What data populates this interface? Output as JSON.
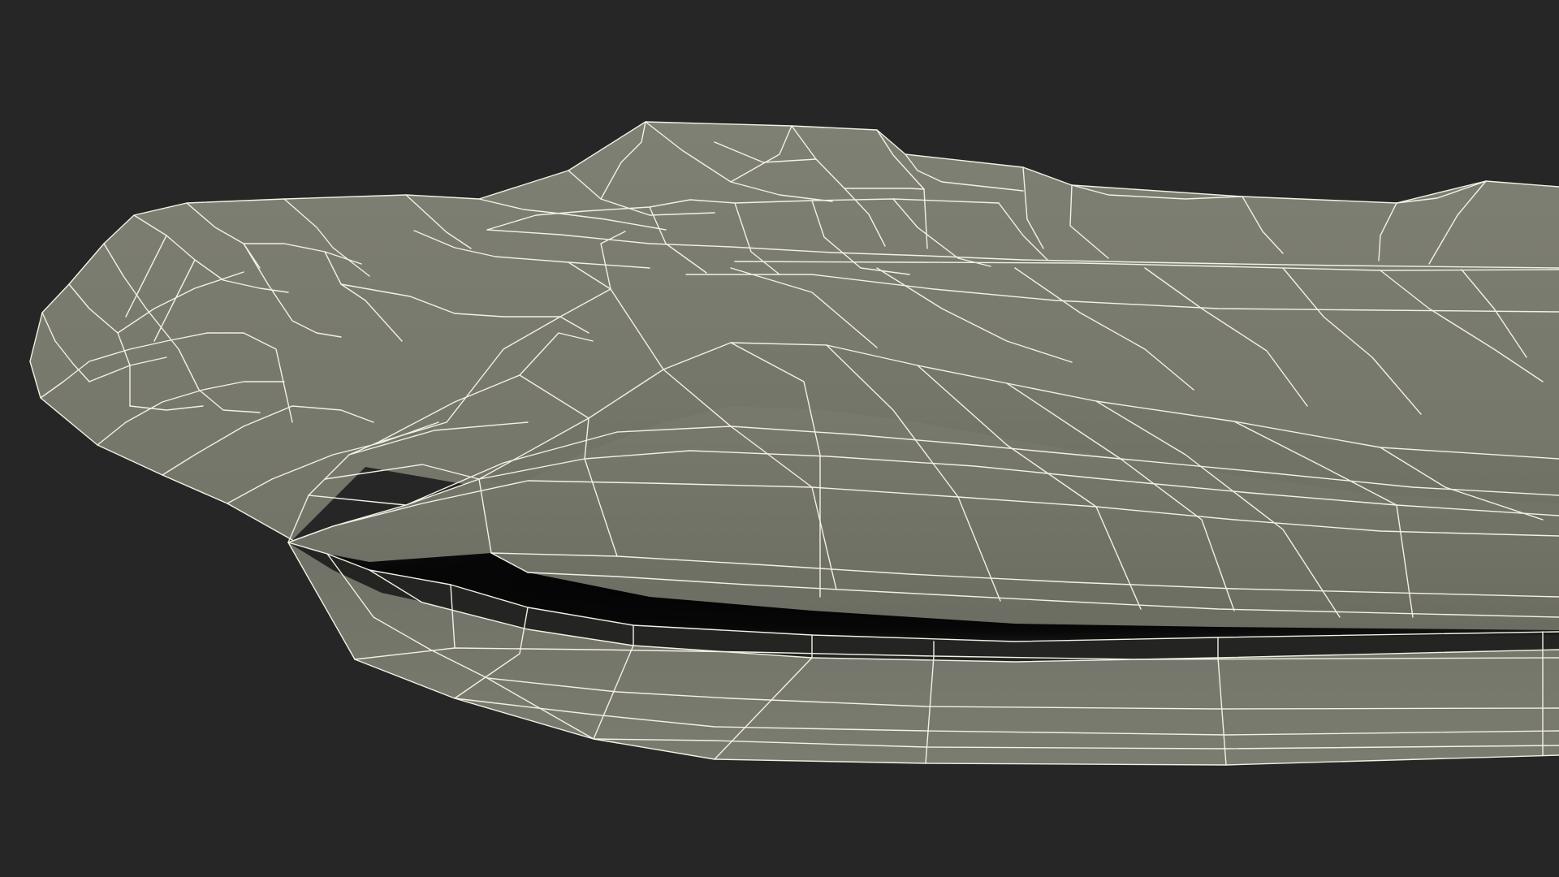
{
  "render": {
    "background_color": "#262626",
    "surface_color": "#7a7b6f",
    "surface_shadow_color": "#6a6b60",
    "wire_color": "#f3f0e4",
    "cavity_color": "#050505"
  }
}
